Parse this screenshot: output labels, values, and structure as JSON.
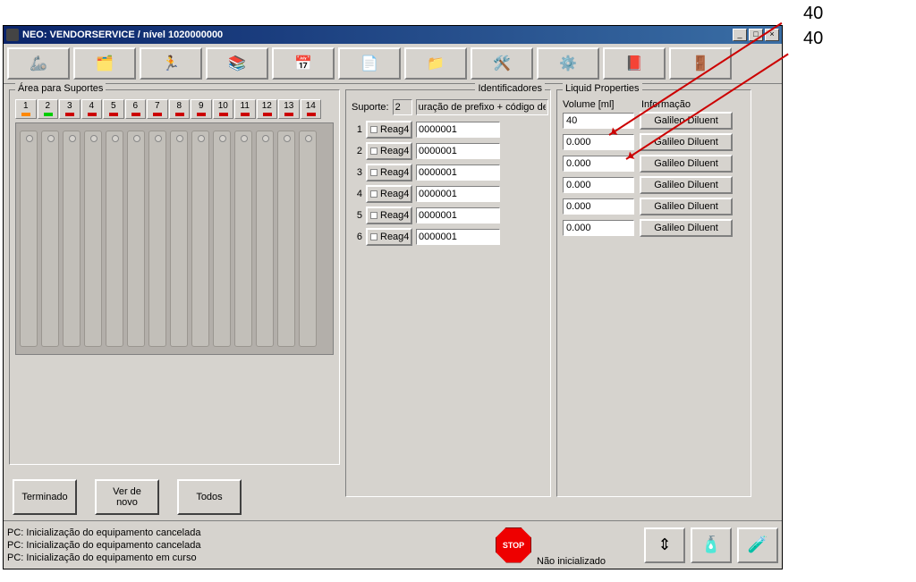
{
  "window": {
    "title": "NEO: VENDORSERVICE / nível 1020000000"
  },
  "toolbar_icons": [
    "arm-icon",
    "card-icon",
    "run-icon",
    "library-icon",
    "schedule-icon",
    "results-icon",
    "folder-icon",
    "tools-icon",
    "gear-icon",
    "help-icon",
    "exit-icon"
  ],
  "supports": {
    "legend": "Área para Suportes",
    "tabs": [
      {
        "num": "1",
        "led": "orange"
      },
      {
        "num": "2",
        "led": "green"
      },
      {
        "num": "3",
        "led": "red"
      },
      {
        "num": "4",
        "led": "red"
      },
      {
        "num": "5",
        "led": "red"
      },
      {
        "num": "6",
        "led": "red"
      },
      {
        "num": "7",
        "led": "red"
      },
      {
        "num": "8",
        "led": "red"
      },
      {
        "num": "9",
        "led": "red"
      },
      {
        "num": "10",
        "led": "red"
      },
      {
        "num": "11",
        "led": "red"
      },
      {
        "num": "12",
        "led": "red"
      },
      {
        "num": "13",
        "led": "red"
      },
      {
        "num": "14",
        "led": "red"
      }
    ],
    "buttons": {
      "done": "Terminado",
      "again": "Ver de novo",
      "all": "Todos"
    }
  },
  "identificadores": {
    "legend": "Identificadores",
    "suporte_label": "Suporte:",
    "suporte_value": "2",
    "suporte_desc": "uração de prefixo + código de",
    "rows": [
      {
        "idx": "1",
        "btn": "Reag4",
        "val": "0000001"
      },
      {
        "idx": "2",
        "btn": "Reag4",
        "val": "0000001"
      },
      {
        "idx": "3",
        "btn": "Reag4",
        "val": "0000001"
      },
      {
        "idx": "4",
        "btn": "Reag4",
        "val": "0000001"
      },
      {
        "idx": "5",
        "btn": "Reag4",
        "val": "0000001"
      },
      {
        "idx": "6",
        "btn": "Reag4",
        "val": "0000001"
      }
    ]
  },
  "liquid": {
    "legend": "Liquid Properties",
    "col_vol": "Volume [ml]",
    "col_info": "Informação",
    "rows": [
      {
        "vol": "40",
        "info": "Galileo Diluent"
      },
      {
        "vol": "0.000",
        "info": "Galileo Diluent"
      },
      {
        "vol": "0.000",
        "info": "Galileo Diluent"
      },
      {
        "vol": "0.000",
        "info": "Galileo Diluent"
      },
      {
        "vol": "0.000",
        "info": "Galileo Diluent"
      },
      {
        "vol": "0.000",
        "info": "Galileo Diluent"
      }
    ]
  },
  "status": {
    "msgs": [
      "PC: Inicialização do equipamento cancelada",
      "PC: Inicialização do equipamento cancelada",
      "PC: Inicialização do equipamento em curso"
    ],
    "stop": "STOP",
    "state": "Não inicializado"
  },
  "annotations": {
    "a1": "40",
    "a2": "40"
  }
}
